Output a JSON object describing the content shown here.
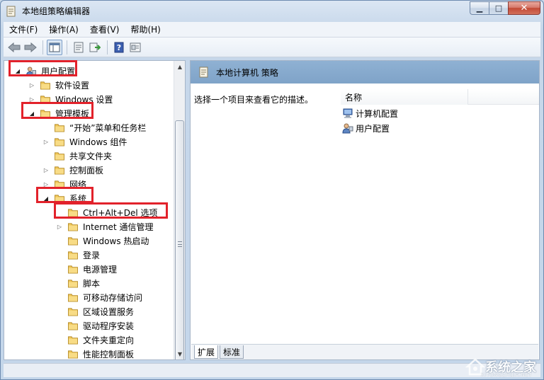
{
  "window": {
    "title": "本地组策略编辑器",
    "minimize_glyph": "▁",
    "maximize_glyph": "□",
    "close_glyph": "✕"
  },
  "menu": [
    "文件(F)",
    "操作(A)",
    "查看(V)",
    "帮助(H)"
  ],
  "toolbar": {
    "buttons": [
      "back-arrow-icon",
      "forward-arrow-icon",
      "show-hide-tree-icon",
      "properties-icon",
      "export-icon",
      "help-icon",
      "filter-icon"
    ]
  },
  "tree": {
    "items": [
      {
        "label": "用户配置",
        "level": 0,
        "expanded": true,
        "icon": "user-config-icon",
        "highlighted": true
      },
      {
        "label": "软件设置",
        "level": 1,
        "expanded": false,
        "has_children": true
      },
      {
        "label": "Windows 设置",
        "level": 1,
        "expanded": false,
        "has_children": true
      },
      {
        "label": "管理模板",
        "level": 1,
        "expanded": true,
        "has_children": true,
        "highlighted": true
      },
      {
        "label": "“开始”菜单和任务栏",
        "level": 2,
        "has_children": false
      },
      {
        "label": "Windows 组件",
        "level": 2,
        "has_children": true
      },
      {
        "label": "共享文件夹",
        "level": 2,
        "has_children": false
      },
      {
        "label": "控制面板",
        "level": 2,
        "has_children": true
      },
      {
        "label": "网络",
        "level": 2,
        "has_children": true
      },
      {
        "label": "系统",
        "level": 2,
        "expanded": true,
        "has_children": true,
        "highlighted": true
      },
      {
        "label": "Ctrl+Alt+Del 选项",
        "level": 3,
        "has_children": false,
        "highlighted": true
      },
      {
        "label": "Internet 通信管理",
        "level": 3,
        "has_children": true
      },
      {
        "label": "Windows 热启动",
        "level": 3,
        "has_children": false
      },
      {
        "label": "登录",
        "level": 3,
        "has_children": false
      },
      {
        "label": "电源管理",
        "level": 3,
        "has_children": false
      },
      {
        "label": "脚本",
        "level": 3,
        "has_children": false
      },
      {
        "label": "可移动存储访问",
        "level": 3,
        "has_children": false
      },
      {
        "label": "区域设置服务",
        "level": 3,
        "has_children": false
      },
      {
        "label": "驱动程序安装",
        "level": 3,
        "has_children": false
      },
      {
        "label": "文件夹重定向",
        "level": 3,
        "has_children": false
      },
      {
        "label": "性能控制面板",
        "level": 3,
        "has_children": false
      }
    ]
  },
  "right_pane": {
    "header": "本地计算机 策略",
    "description": "选择一个项目来查看它的描述。",
    "column_name": "名称",
    "items": [
      {
        "label": "计算机配置",
        "icon": "computer-config-icon"
      },
      {
        "label": "用户配置",
        "icon": "user-config-icon"
      }
    ],
    "tabs": [
      "扩展",
      "标准"
    ]
  },
  "watermark": {
    "text": "系统之家",
    "sub": "XITONGZHIJIA.NET"
  },
  "colors": {
    "highlight_box": "#e2222b",
    "pane_header": "#7fa3c8",
    "folder": "#f2c85a"
  }
}
